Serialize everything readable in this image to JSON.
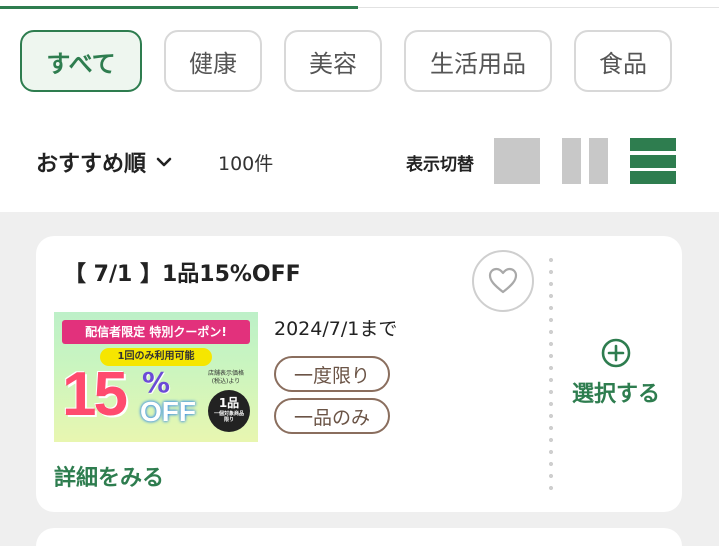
{
  "categories": [
    {
      "label": "すべて",
      "active": true
    },
    {
      "label": "健康",
      "active": false
    },
    {
      "label": "美容",
      "active": false
    },
    {
      "label": "生活用品",
      "active": false
    },
    {
      "label": "食品",
      "active": false
    }
  ],
  "sort": {
    "label": "おすすめ順",
    "count": "100件"
  },
  "view_toggle": {
    "label": "表示切替",
    "modes": [
      "grid-large-icon",
      "grid-two-column-icon",
      "list-icon"
    ],
    "active_mode": "list-icon"
  },
  "coupon": {
    "title": "【 7/1 】1品15%OFF",
    "until": "2024/7/1まで",
    "tags": [
      "一度限り",
      "一品のみ"
    ],
    "detail_link": "詳細をみる",
    "select_label": "選択する",
    "image": {
      "banner": "配信者限定 特別クーポン!",
      "pill": "1回のみ利用可能",
      "number": "15",
      "percent": "%",
      "off": "OFF",
      "note": "店舗表示価格(税込)より",
      "circle_main": "1品",
      "circle_sub": "一個対象商品限り"
    }
  },
  "colors": {
    "accent": "#2e7d4f",
    "list_bg": "#efefef",
    "tag_border": "#8a6e5e"
  }
}
